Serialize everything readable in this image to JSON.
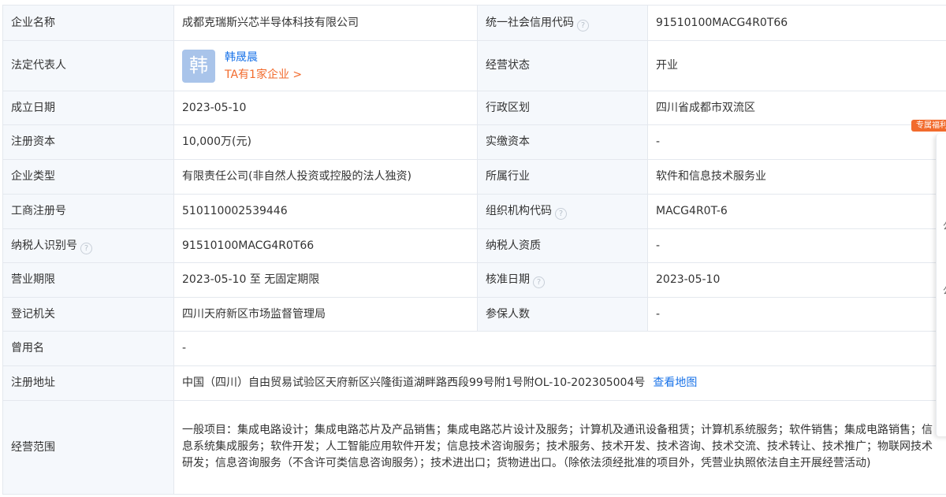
{
  "rows": {
    "r1": {
      "l1": "企业名称",
      "v1": "成都克瑞斯兴芯半导体科技有限公司",
      "l2": "统一社会信用代码",
      "v2": "91510100MACG4R0T66"
    },
    "r2": {
      "l1": "法定代表人",
      "avatar_char": "韩",
      "rep_name": "韩晟晨",
      "rep_link": "TA有1家企业 >",
      "l2": "经营状态",
      "v2": "开业"
    },
    "r3": {
      "l1": "成立日期",
      "v1": "2023-05-10",
      "l2": "行政区划",
      "v2": "四川省成都市双流区"
    },
    "r4": {
      "l1": "注册资本",
      "v1": "10,000万(元)",
      "l2": "实缴资本",
      "v2": "-"
    },
    "r5": {
      "l1": "企业类型",
      "v1": "有限责任公司(非自然人投资或控股的法人独资)",
      "l2": "所属行业",
      "v2": "软件和信息技术服务业"
    },
    "r6": {
      "l1": "工商注册号",
      "v1": "510110002539446",
      "l2": "组织机构代码",
      "v2": "MACG4R0T-6"
    },
    "r7": {
      "l1": "纳税人识别号",
      "v1": "91510100MACG4R0T66",
      "l2": "纳税人资质",
      "v2": "-"
    },
    "r8": {
      "l1": "营业期限",
      "v1": "2023-05-10 至 无固定期限",
      "l2": "核准日期",
      "v2": "2023-05-10"
    },
    "r9": {
      "l1": "登记机关",
      "v1": "四川天府新区市场监督管理局",
      "l2": "参保人数",
      "v2": "-"
    },
    "r10": {
      "l1": "曾用名",
      "v1": "-"
    },
    "r11": {
      "l1": "注册地址",
      "v1": "中国（四川）自由贸易试验区天府新区兴隆街道湖畔路西段99号附1号附OL-10-202305004号",
      "map_link": "查看地图"
    },
    "r12": {
      "l1": "经营范围",
      "v1": "一般项目：集成电路设计；集成电路芯片及产品销售；集成电路芯片设计及服务；计算机及通讯设备租赁；计算机系统服务；软件销售；集成电路销售；信息系统集成服务；软件开发；人工智能应用软件开发；信息技术咨询服务；技术服务、技术开发、技术咨询、技术交流、技术转让、技术推广；物联网技术研发；信息咨询服务（不含许可类信息咨询服务）；技术进出口；货物进出口。（除依法须经批准的项目外，凭营业执照依法自主开展经营活动)"
    }
  },
  "help_glyph": "?",
  "side": {
    "tag": "专属福利",
    "ch1": "公",
    "ch2": "公"
  },
  "colors": {
    "label_bg": "#f5f8fc",
    "border": "#e4e8ee",
    "link_blue": "#1a73e8",
    "accent_orange": "#f26b2d",
    "avatar_bg": "#a9c4ea"
  }
}
